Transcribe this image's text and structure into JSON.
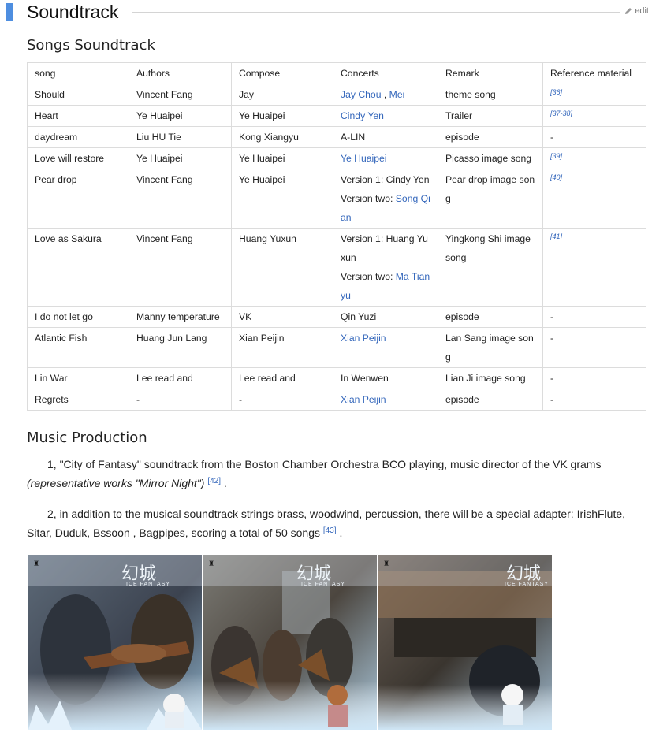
{
  "section": {
    "title": "Soundtrack",
    "edit_label": "edit"
  },
  "songs": {
    "heading": "Songs Soundtrack",
    "columns": [
      "song",
      "Authors",
      "Compose",
      "Concerts",
      "Remark",
      "Reference material"
    ],
    "rows": [
      {
        "song": "Should",
        "authors": "Vincent Fang",
        "compose": "Jay",
        "concerts": [
          {
            "text": "Jay Chou",
            "link": true
          },
          {
            "text": " , ",
            "link": false
          },
          {
            "text": "Mei",
            "link": true
          }
        ],
        "remark": "theme song",
        "ref": "[36]"
      },
      {
        "song": "Heart",
        "authors": "Ye Huaipei",
        "compose": "Ye Huaipei",
        "concerts": [
          {
            "text": "Cindy Yen",
            "link": true
          }
        ],
        "remark": "Trailer",
        "ref": "[37-38]"
      },
      {
        "song": "daydream",
        "authors": "Liu HU Tie",
        "compose": "Kong Xiangyu",
        "concerts": [
          {
            "text": "A-LIN",
            "link": false
          }
        ],
        "remark": "episode",
        "ref": "-"
      },
      {
        "song": "Love will restore",
        "authors": "Ye Huaipei",
        "compose": "Ye Huaipei",
        "concerts": [
          {
            "text": "Ye Huaipei",
            "link": true
          }
        ],
        "remark": "Picasso image song",
        "ref": "[39]"
      },
      {
        "song": "Pear drop",
        "authors": "Vincent Fang",
        "compose": "Ye Huaipei",
        "concerts_lines": [
          [
            {
              "text": "Version 1: Cindy Yen",
              "link": false
            }
          ],
          [
            {
              "text": "Version two: ",
              "link": false
            },
            {
              "text": "Song Qian",
              "link": true
            }
          ]
        ],
        "remark": "Pear drop image song",
        "ref": "[40]"
      },
      {
        "song": "Love as Sakura",
        "authors": "Vincent Fang",
        "compose": "Huang Yuxun",
        "concerts_lines": [
          [
            {
              "text": "Version 1: Huang Yuxun",
              "link": false
            }
          ],
          [
            {
              "text": "Version two: ",
              "link": false
            },
            {
              "text": "Ma Tianyu",
              "link": true
            }
          ]
        ],
        "remark": "Yingkong Shi image song",
        "ref": "[41]"
      },
      {
        "song": "I do not let go",
        "authors": "Manny temperature",
        "compose": "VK",
        "concerts": [
          {
            "text": "Qin Yuzi",
            "link": false
          }
        ],
        "remark": "episode",
        "ref": "-"
      },
      {
        "song": "Atlantic Fish",
        "authors": "Huang Jun Lang",
        "compose": "Xian Peijin",
        "concerts": [
          {
            "text": "Xian Peijin",
            "link": true
          }
        ],
        "remark": "Lan Sang image song",
        "ref": "-"
      },
      {
        "song": "Lin War",
        "authors": "Lee read and",
        "compose": "Lee read and",
        "concerts": [
          {
            "text": "In Wenwen",
            "link": false
          }
        ],
        "remark": "Lian Ji image song",
        "ref": "-"
      },
      {
        "song": "Regrets",
        "authors": "-",
        "compose": "-",
        "concerts": [
          {
            "text": "Xian Peijin",
            "link": true
          }
        ],
        "remark": "episode",
        "ref": "-"
      }
    ]
  },
  "production": {
    "heading": "Music Production",
    "p1_text": "1, \"City of Fantasy\" soundtrack from the Boston Chamber Orchestra BCO playing, music director of the VK grams",
    "p1_italic": "(representative works \"Mirror Night\")",
    "p1_ref": "[42]",
    "p1_end": " .",
    "p2_text": "2, in addition to the musical soundtrack strings brass, woodwind, percussion, there will be a special adapter: IrishFlute, Sitar, Duduk, Bssoon , Bagpipes, scoring a total of 50 songs",
    "p2_ref": "[43]",
    "p2_end": " ."
  },
  "gallery": {
    "images": [
      {
        "logo_text": "幻城",
        "sub_text": "ICE FANTASY"
      },
      {
        "logo_text": "幻城",
        "sub_text": "ICE FANTASY"
      },
      {
        "logo_text": "幻城",
        "sub_text": "ICE FANTASY"
      }
    ]
  },
  "colors": {
    "accent": "#4e8ee0",
    "link": "#3366bb"
  }
}
